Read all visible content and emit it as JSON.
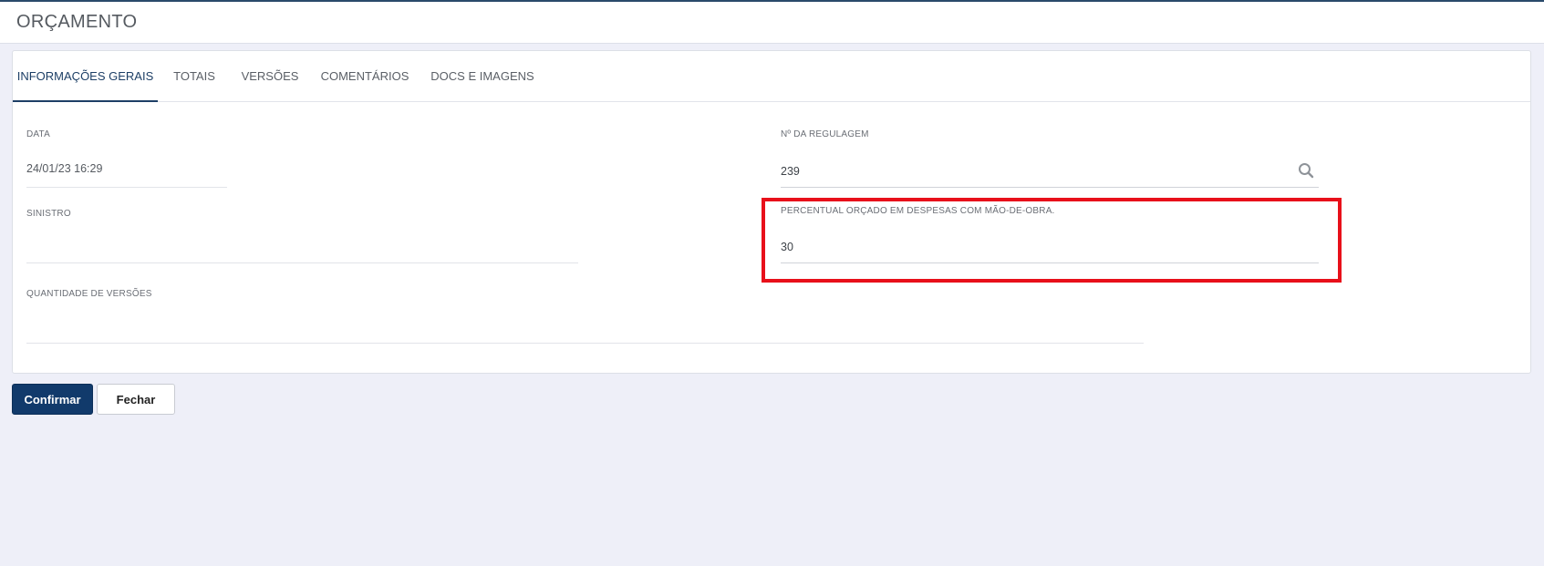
{
  "header": {
    "title": "ORÇAMENTO"
  },
  "tabs": [
    {
      "label": "INFORMAÇÕES GERAIS",
      "active": true
    },
    {
      "label": "TOTAIS",
      "active": false
    },
    {
      "label": "VERSÕES",
      "active": false
    },
    {
      "label": "COMENTÁRIOS",
      "active": false
    },
    {
      "label": "DOCS E IMAGENS",
      "active": false
    }
  ],
  "fields": {
    "data": {
      "label": "DATA",
      "value": "24/01/23 16:29"
    },
    "regulagem": {
      "label": "Nº DA REGULAGEM",
      "value": "239"
    },
    "sinistro": {
      "label": "SINISTRO",
      "value": ""
    },
    "percentual": {
      "label": "PERCENTUAL ORÇADO EM DESPESAS COM MÃO-DE-OBRA.",
      "value": "30"
    },
    "versoes": {
      "label": "QUANTIDADE DE VERSÕES",
      "value": ""
    }
  },
  "buttons": {
    "confirm": "Confirmar",
    "close": "Fechar"
  },
  "colors": {
    "primary": "#113a6b",
    "highlight": "#e8101a",
    "tab_active": "#1d3f66"
  }
}
